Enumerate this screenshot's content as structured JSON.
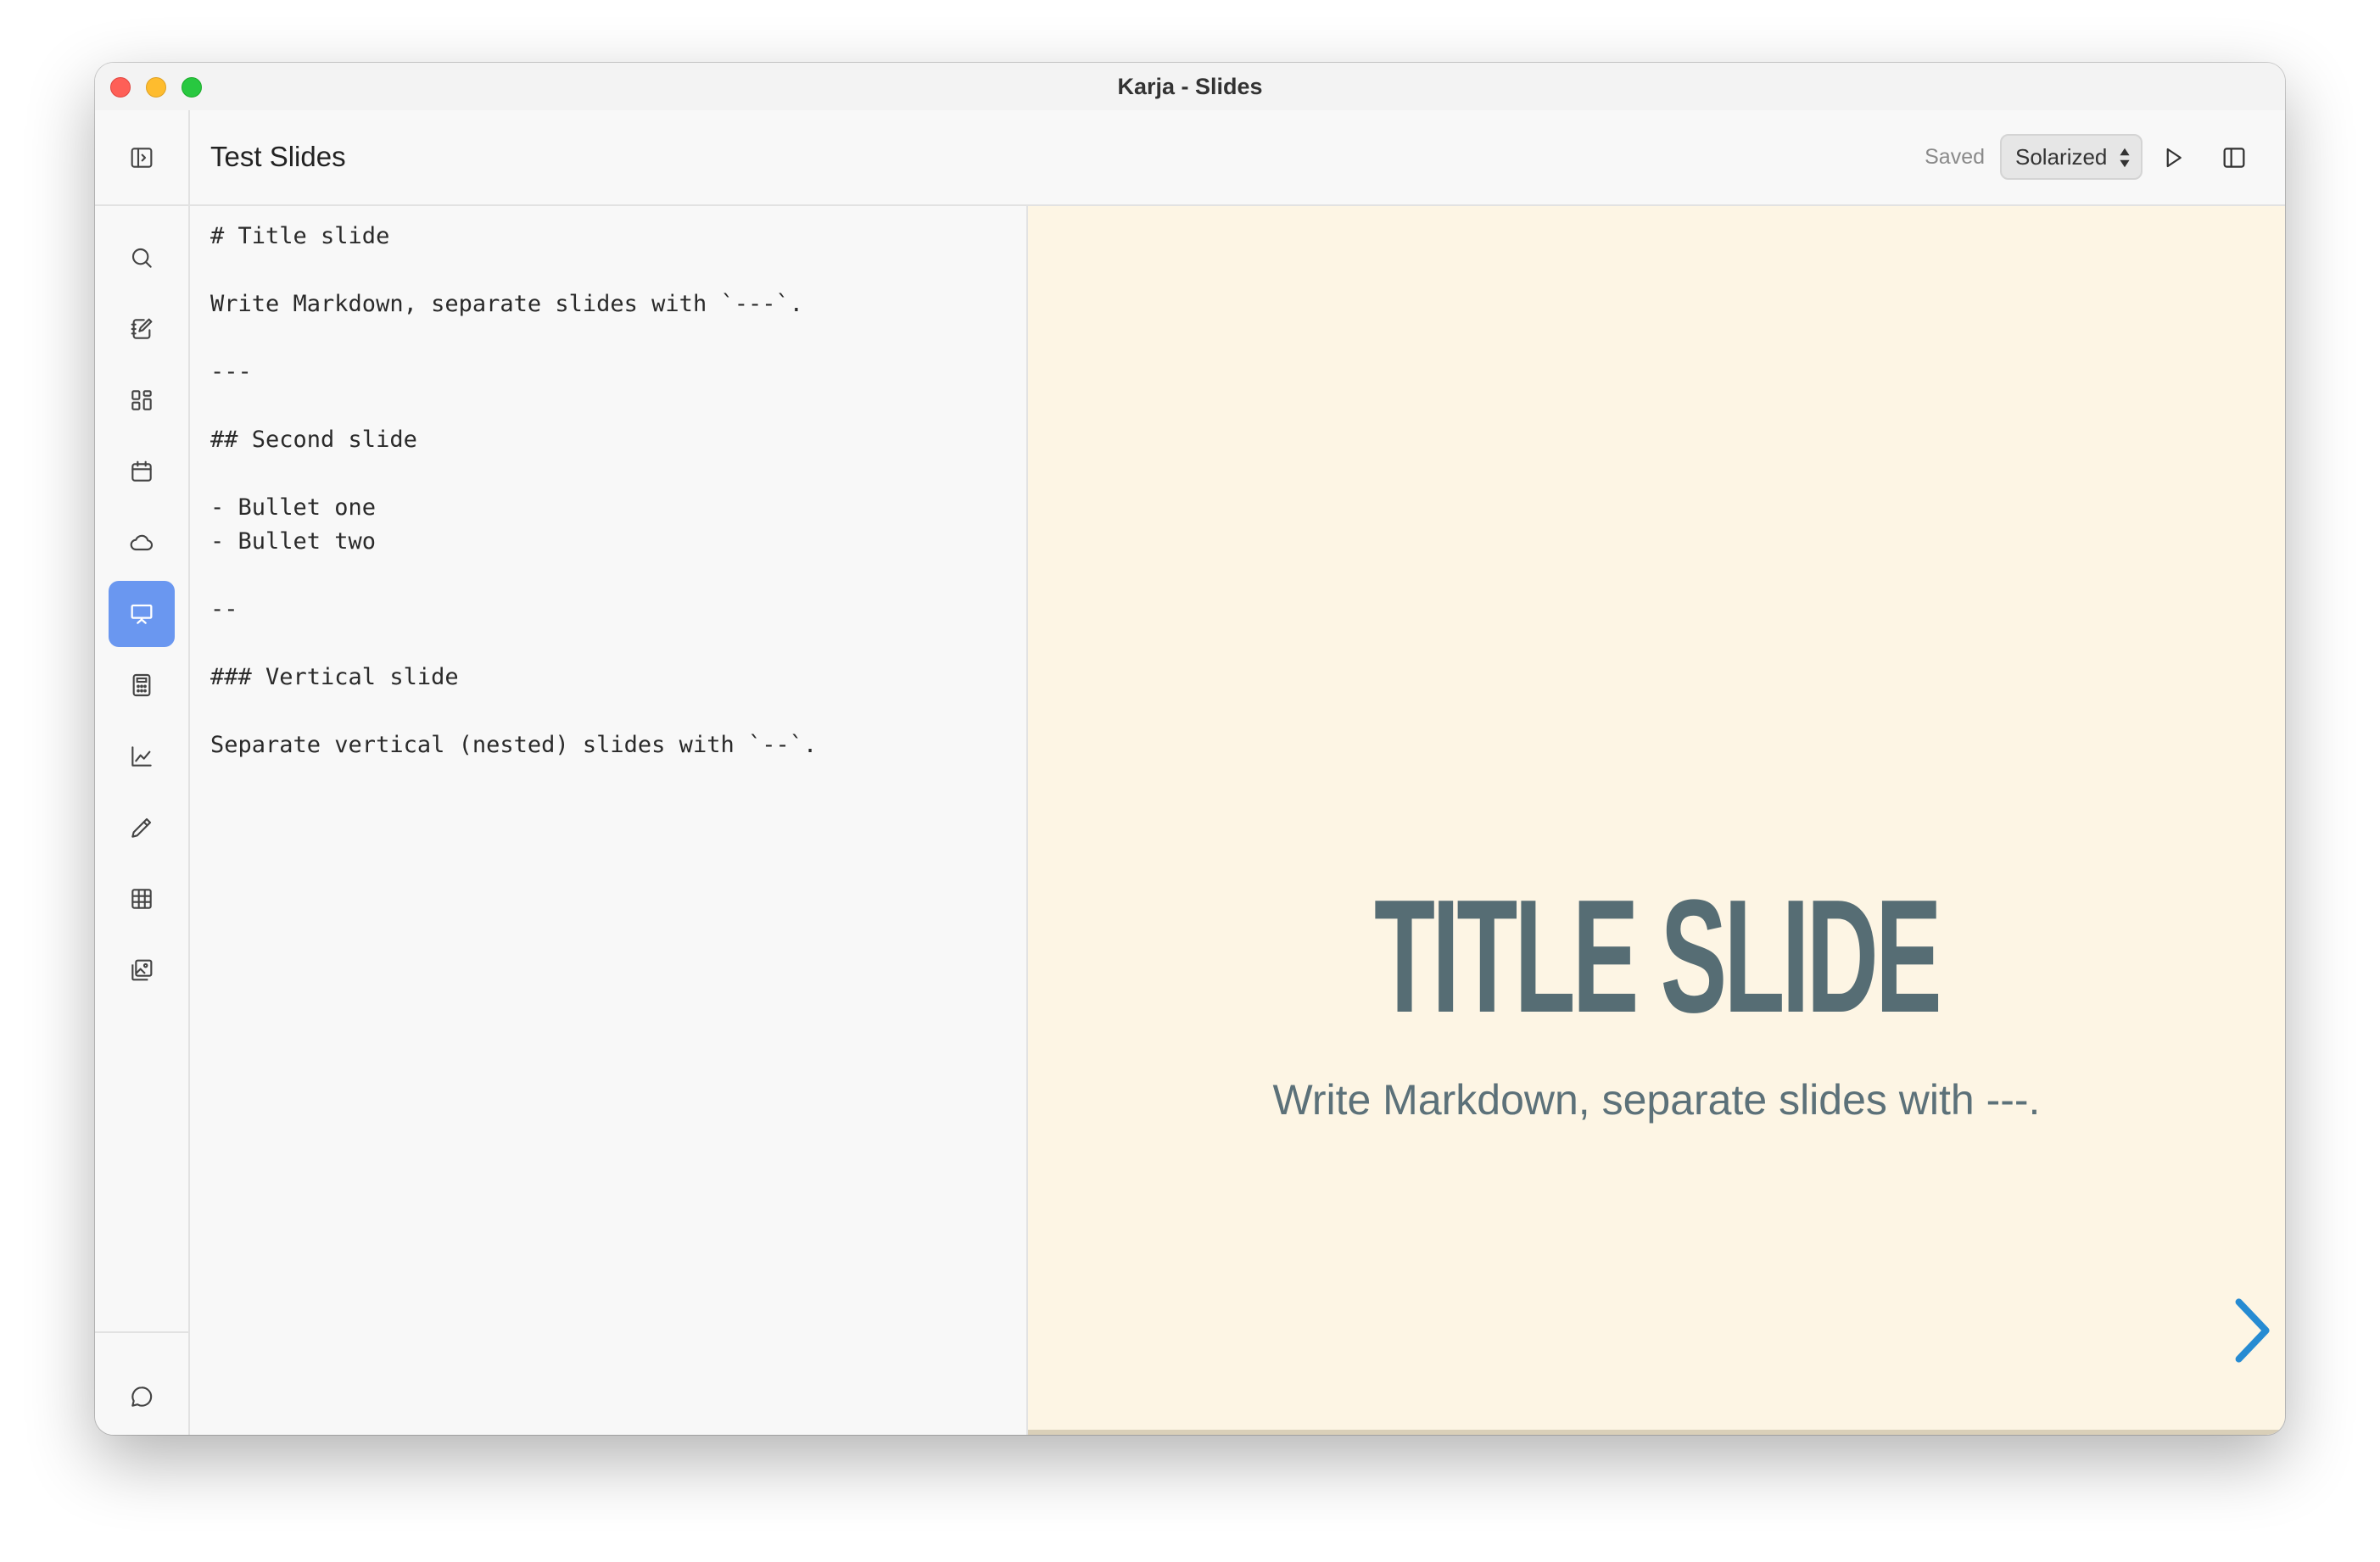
{
  "window": {
    "title": "Karja - Slides"
  },
  "sidebar": {
    "toggle_icon": "sidebar-toggle-icon",
    "items": [
      {
        "icon": "search-icon",
        "active": false
      },
      {
        "icon": "notes-icon",
        "active": false
      },
      {
        "icon": "apps-grid-icon",
        "active": false
      },
      {
        "icon": "calendar-icon",
        "active": false
      },
      {
        "icon": "cloud-icon",
        "active": false
      },
      {
        "icon": "presentation-icon",
        "active": true
      },
      {
        "icon": "calculator-icon",
        "active": false
      },
      {
        "icon": "chart-icon",
        "active": false
      },
      {
        "icon": "pencil-icon",
        "active": false
      },
      {
        "icon": "table-icon",
        "active": false
      },
      {
        "icon": "gallery-icon",
        "active": false
      }
    ],
    "bottom": [
      {
        "icon": "chat-icon"
      },
      {
        "icon": "settings-gear-icon"
      }
    ],
    "active_color": "#6a97f0"
  },
  "topbar": {
    "doc_title": "Test Slides",
    "status": "Saved",
    "theme_value": "Solarized"
  },
  "editor": {
    "lines": [
      "# Title slide",
      "Write Markdown, separate slides with `---`.",
      "---",
      "## Second slide",
      "- Bullet one",
      "- Bullet two",
      "--",
      "### Vertical slide",
      "Separate vertical (nested) slides with `--`."
    ]
  },
  "preview": {
    "background": "#fdf5e4",
    "title": "TITLE SLIDE",
    "subtitle": "Write Markdown, separate slides with ---.",
    "text_color": "#566d74",
    "accent": "#268bd2"
  }
}
